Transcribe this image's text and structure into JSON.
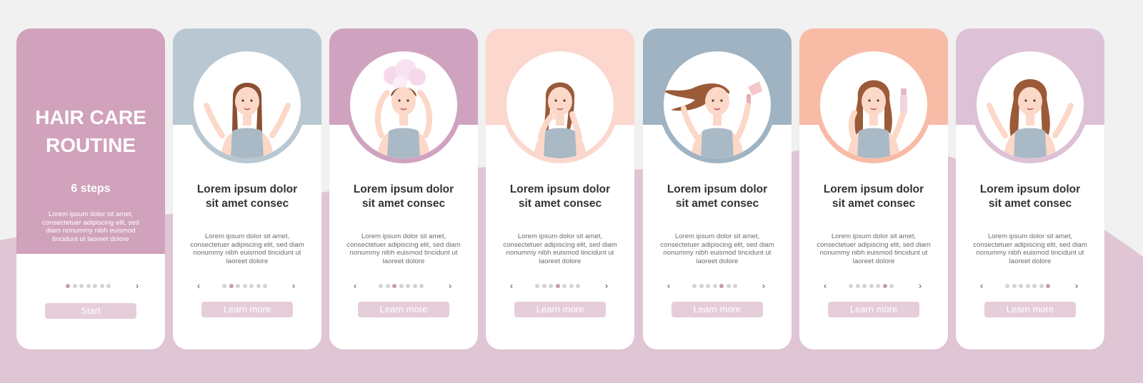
{
  "intro": {
    "title": "HAIR CARE\nROUTINE",
    "steps_label": "6 steps",
    "description": "Lorem ipsum dolor sit amet, consectetuer adipiscing elit, sed diam nonummy nibh euismod tincidunt ut laoreet dolore",
    "start_label": "Start",
    "next_icon": "chevron-right-icon",
    "active_dot": 0,
    "dot_count": 7
  },
  "steps": [
    {
      "title": "Lorem ipsum dolor\nsit amet consec",
      "description": "Lorem ipsum dolor sit amet, consectetuer adipiscing elit, sed diam nonummy nibh euismod tincidunt ut laoreet dolore",
      "button_label": "Learn more",
      "illustration": "confused-woman-icon",
      "active_dot": 1,
      "accent": "#b8c7d1"
    },
    {
      "title": "Lorem ipsum dolor\nsit amet consec",
      "description": "Lorem ipsum dolor sit amet, consectetuer adipiscing elit, sed diam nonummy nibh euismod tincidunt ut laoreet dolore",
      "button_label": "Learn more",
      "illustration": "shampoo-foam-woman-icon",
      "active_dot": 2,
      "accent": "#cfa3bf"
    },
    {
      "title": "Lorem ipsum dolor\nsit amet consec",
      "description": "Lorem ipsum dolor sit amet, consectetuer adipiscing elit, sed diam nonummy nibh euismod tincidunt ut laoreet dolore",
      "button_label": "Learn more",
      "illustration": "towel-dry-woman-icon",
      "active_dot": 3,
      "accent": "#fbd7cd"
    },
    {
      "title": "Lorem ipsum dolor\nsit amet consec",
      "description": "Lorem ipsum dolor sit amet, consectetuer adipiscing elit, sed diam nonummy nibh euismod tincidunt ut laoreet dolore",
      "button_label": "Learn more",
      "illustration": "hair-dryer-woman-icon",
      "active_dot": 4,
      "accent": "#9fb3c2"
    },
    {
      "title": "Lorem ipsum dolor\nsit amet consec",
      "description": "Lorem ipsum dolor sit amet, consectetuer adipiscing elit, sed diam nonummy nibh euismod tincidunt ut laoreet dolore",
      "button_label": "Learn more",
      "illustration": "hair-spray-woman-icon",
      "active_dot": 5,
      "accent": "#f8bba6"
    },
    {
      "title": "Lorem ipsum dolor\nsit amet consec",
      "description": "Lorem ipsum dolor sit amet, consectetuer adipiscing elit, sed diam nonummy nibh euismod tincidunt ut laoreet dolore",
      "button_label": "Learn more",
      "illustration": "happy-woman-icon",
      "active_dot": 6,
      "accent": "#ddc1d6"
    }
  ],
  "icons": {
    "prev": "chevron-left-icon",
    "next": "chevron-right-icon"
  },
  "glyphs": {
    "prev": "‹",
    "next": "›"
  },
  "colors": {
    "intro_panel": "#d1a2bb",
    "page_background": "#f1f1f1",
    "wave": "#e0c6d4",
    "dot_inactive": "#d4d4d4",
    "dot_active": "#c99bb4",
    "button": "#e6cdda",
    "skin": "#fbd8c8",
    "dress": "#a9b9c6"
  }
}
